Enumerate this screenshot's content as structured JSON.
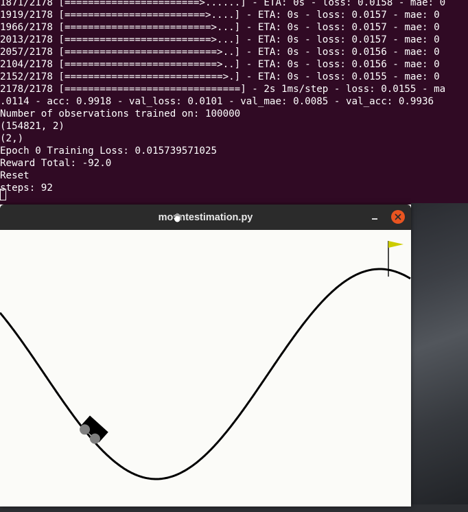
{
  "terminal": {
    "lines": [
      "1871/2178 [=======================>......] - ETA: 0s - loss: 0.0158 - mae: 0",
      "1919/2178 [========================>....] - ETA: 0s - loss: 0.0157 - mae: 0",
      "1966/2178 [=========================>...] - ETA: 0s - loss: 0.0157 - mae: 0",
      "2013/2178 [=========================>...] - ETA: 0s - loss: 0.0157 - mae: 0",
      "2057/2178 [==========================>..] - ETA: 0s - loss: 0.0156 - mae: 0",
      "2104/2178 [==========================>..] - ETA: 0s - loss: 0.0156 - mae: 0",
      "2152/2178 [===========================>.] - ETA: 0s - loss: 0.0155 - mae: 0",
      "2178/2178 [==============================] - 2s 1ms/step - loss: 0.0155 - ma",
      ".0114 - acc: 0.9918 - val_loss: 0.0101 - val_mae: 0.0085 - val_acc: 0.9936",
      "Number of observations trained on: 100000",
      "(154821, 2)",
      "(2,)",
      "Epoch 0 Training Loss: 0.015739571025",
      "Reward Total: -92.0",
      "Reset",
      "steps: 92"
    ]
  },
  "window": {
    "title": "mountestimation.py",
    "title_color": "#e8e8e8",
    "titlebar_color": "#2b2b2b",
    "close_color": "#e95420",
    "buttons": {
      "minimize_icon": "minimize-icon",
      "close_icon": "close-icon"
    }
  },
  "scene": {
    "environment": "mountain-car",
    "background": "#fbfbf8",
    "track_color": "#000000",
    "car_color": "#000000",
    "wheel_color": "#7f7f7f",
    "flag_color": "#cccc00"
  }
}
